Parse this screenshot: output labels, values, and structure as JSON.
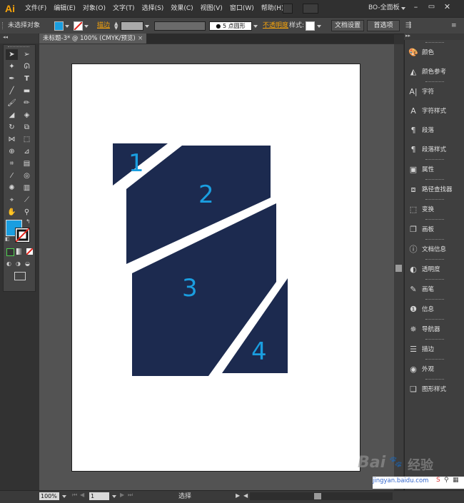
{
  "app": {
    "logo": "Ai",
    "workspace": "BO-全面板"
  },
  "menu": [
    "文件(F)",
    "编辑(E)",
    "对象(O)",
    "文字(T)",
    "选择(S)",
    "效果(C)",
    "视图(V)",
    "窗口(W)",
    "帮助(H)"
  ],
  "control": {
    "selection_status": "未选择对象",
    "stroke_label": "描边",
    "brush": "5 点圆形",
    "opacity_label": "不透明度",
    "style_label": "样式:",
    "doc_setup": "文档设置",
    "preferences": "首选项"
  },
  "document": {
    "tab_title": "未标题-3* @ 100% (CMYK/预览)"
  },
  "artwork": {
    "labels": [
      "1",
      "2",
      "3",
      "4"
    ]
  },
  "status": {
    "zoom": "100%",
    "page": "1",
    "tool_status": "选择"
  },
  "panels": [
    {
      "icon": "color-icon",
      "label": "颜色"
    },
    {
      "icon": "color-guide-icon",
      "label": "颜色参考"
    },
    {
      "icon": "character-icon",
      "label": "字符"
    },
    {
      "icon": "character-styles-icon",
      "label": "字符样式"
    },
    {
      "icon": "paragraph-icon",
      "label": "段落"
    },
    {
      "icon": "paragraph-styles-icon",
      "label": "段落样式"
    },
    {
      "icon": "attributes-icon",
      "label": "属性"
    },
    {
      "icon": "pathfinder-icon",
      "label": "路径查找器"
    },
    {
      "icon": "transform-icon",
      "label": "变换"
    },
    {
      "icon": "artboards-icon",
      "label": "画板"
    },
    {
      "icon": "document-info-icon",
      "label": "文档信息"
    },
    {
      "icon": "transparency-icon",
      "label": "透明度"
    },
    {
      "icon": "brushes-icon",
      "label": "画笔"
    },
    {
      "icon": "info-icon",
      "label": "信息"
    },
    {
      "icon": "navigator-icon",
      "label": "导航器"
    },
    {
      "icon": "stroke-icon",
      "label": "描边"
    },
    {
      "icon": "appearance-icon",
      "label": "外观"
    },
    {
      "icon": "graphic-styles-icon",
      "label": "图形样式"
    }
  ],
  "watermark": {
    "brand": "Bai",
    "brand_suffix": "经验",
    "url": "jingyan.baidu.com"
  },
  "colors": {
    "fill": "#1a9ee0",
    "shape": "#1c2a4f",
    "shape_label": "#1a9ee0",
    "accent_orange": "#f7a40b"
  }
}
